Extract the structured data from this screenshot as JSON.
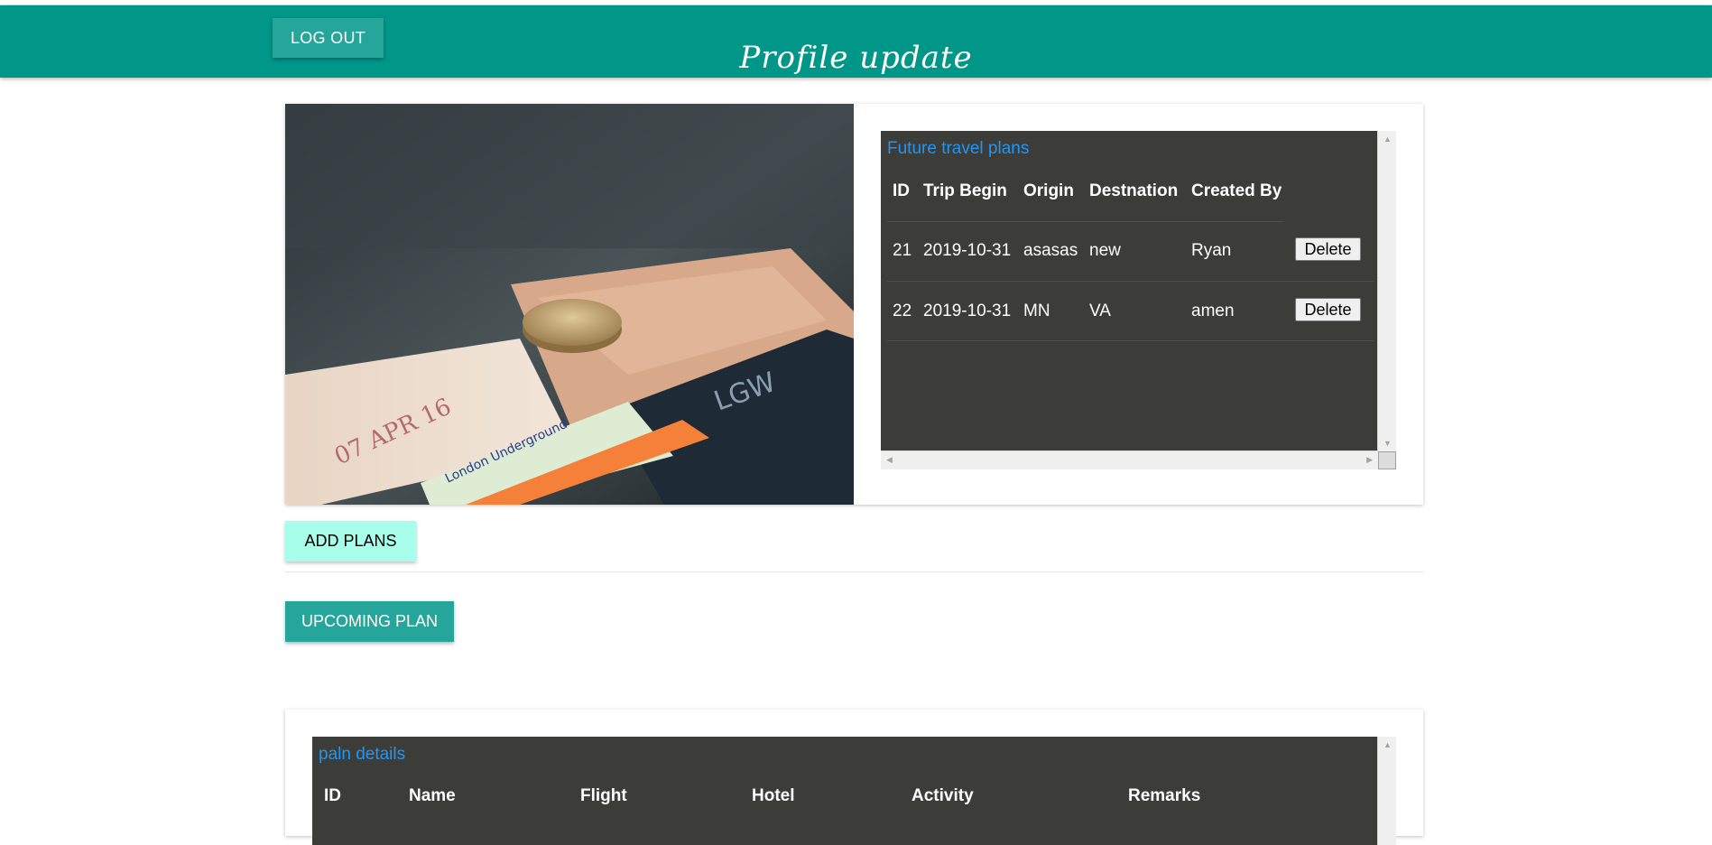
{
  "header": {
    "logout_label": "LOG OUT",
    "title": "Profile update",
    "background_color": "#009688"
  },
  "future_plans": {
    "caption": "Future travel plans",
    "columns": [
      "ID",
      "Trip Begin",
      "Origin",
      "Destnation",
      "Created By"
    ],
    "rows": [
      {
        "id": "21",
        "trip_begin": "2019-10-31",
        "origin": "asasas",
        "destination": "new",
        "created_by": "Ryan",
        "action": "Delete"
      },
      {
        "id": "22",
        "trip_begin": "2019-10-31",
        "origin": "MN",
        "destination": "VA",
        "created_by": "amen",
        "action": "Delete"
      }
    ]
  },
  "actions": {
    "add_plans_label": "ADD PLANS",
    "upcoming_plan_label": "UPCOMING PLAN"
  },
  "plan_details": {
    "caption": "paln details",
    "columns": [
      "ID",
      "Name",
      "Flight",
      "Hotel",
      "Activity",
      "Remarks"
    ]
  },
  "colors": {
    "accent": "#26a69a",
    "add_button": "#a7ffeb",
    "table_bg": "#3c3d38",
    "caption_blue": "#2196f3"
  },
  "icons": {
    "photo": "travel-tickets-photo",
    "scroll_up": "scroll-up-arrow-icon",
    "scroll_down": "scroll-down-arrow-icon",
    "scroll_left": "scroll-left-arrow-icon",
    "scroll_right": "scroll-right-arrow-icon"
  }
}
